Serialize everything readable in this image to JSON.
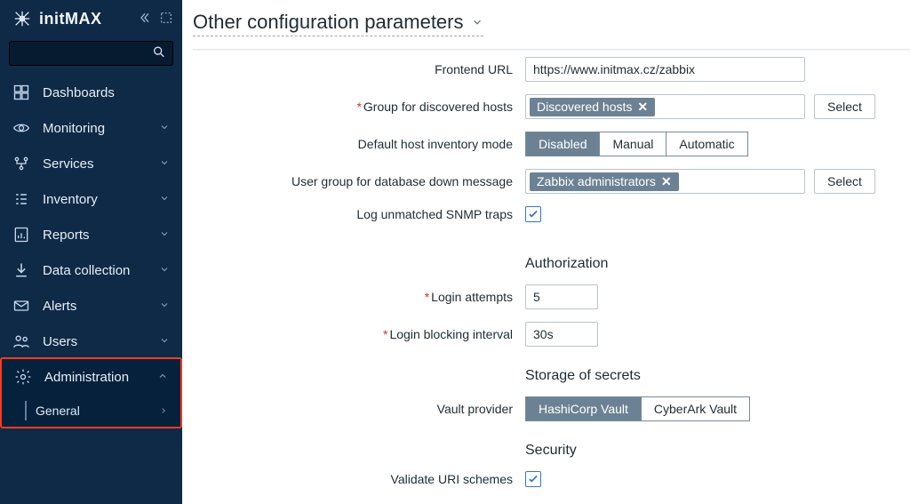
{
  "brand": "initMAX",
  "search": {
    "placeholder": ""
  },
  "sidebar": {
    "items": [
      {
        "label": "Dashboards"
      },
      {
        "label": "Monitoring"
      },
      {
        "label": "Services"
      },
      {
        "label": "Inventory"
      },
      {
        "label": "Reports"
      },
      {
        "label": "Data collection"
      },
      {
        "label": "Alerts"
      },
      {
        "label": "Users"
      }
    ],
    "admin": {
      "label": "Administration",
      "sub": {
        "label": "General"
      }
    }
  },
  "page": {
    "title": "Other configuration parameters"
  },
  "form": {
    "frontend_url": {
      "label": "Frontend URL",
      "value": "https://www.initmax.cz/zabbix"
    },
    "group_discovered": {
      "label": "Group for discovered hosts",
      "tag": "Discovered hosts",
      "select": "Select"
    },
    "inventory_mode": {
      "label": "Default host inventory mode",
      "options": [
        "Disabled",
        "Manual",
        "Automatic"
      ],
      "selected": 0
    },
    "db_down_group": {
      "label": "User group for database down message",
      "tag": "Zabbix administrators",
      "select": "Select"
    },
    "snmp_traps": {
      "label": "Log unmatched SNMP traps",
      "checked": true
    },
    "sections": {
      "authorization": "Authorization",
      "login_attempts": {
        "label": "Login attempts",
        "value": "5"
      },
      "login_block": {
        "label": "Login blocking interval",
        "value": "30s"
      },
      "storage": "Storage of secrets",
      "vault": {
        "label": "Vault provider",
        "options": [
          "HashiCorp Vault",
          "CyberArk Vault"
        ],
        "selected": 0
      },
      "security": "Security",
      "validate_uri": {
        "label": "Validate URI schemes",
        "checked": true
      }
    }
  }
}
